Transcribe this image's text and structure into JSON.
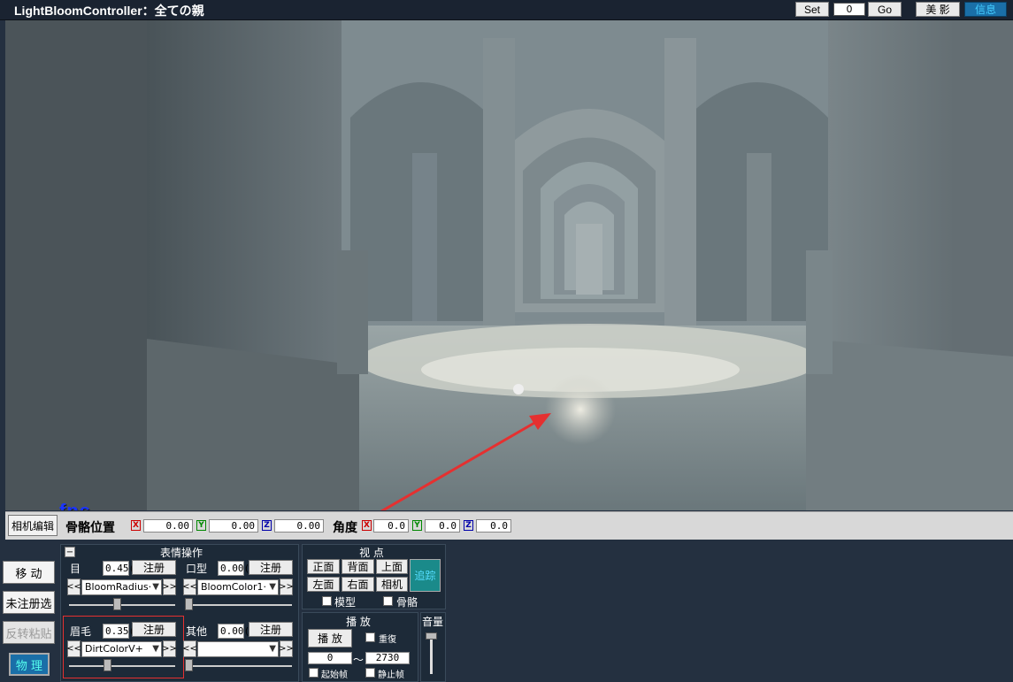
{
  "window": {
    "title": "LightBloomController：全ての親"
  },
  "titlebar": {
    "set_label": "Set",
    "frame_value": "0",
    "go_label": "Go",
    "beauty_label": "美 影",
    "info_label": "信息",
    "accent_color": "#1a6fa8"
  },
  "viewport": {
    "fps_label": "—fps"
  },
  "bone_bar": {
    "camera_edit_label": "相机编辑",
    "bone_position_label": "骨骼位置",
    "angle_label": "角度",
    "axis_labels": [
      "X",
      "Y",
      "Z"
    ],
    "position": {
      "x": "0.00",
      "y": "0.00",
      "z": "0.00"
    },
    "angle": {
      "x": "0.0",
      "y": "0.0",
      "z": "0.0"
    }
  },
  "left_buttons": {
    "move": "移 动",
    "unregistered_select": "未注册选",
    "reverse_paste": "反转粘贴",
    "physics": "物 理"
  },
  "expression": {
    "collapse_label": "−",
    "title": "表情操作",
    "register_label": "注册",
    "eye": {
      "label": "目",
      "value": "0.45(",
      "morph": "BloomRadius·"
    },
    "mouth": {
      "label": "口型",
      "value": "0.00(",
      "morph": "BloomColor1·"
    },
    "brow": {
      "label": "眉毛",
      "value": "0.35(",
      "morph": "DirtColorV+"
    },
    "other": {
      "label": "其他",
      "value": "0.00(",
      "morph": ""
    },
    "prev": "<<",
    "next": ">>"
  },
  "view": {
    "title": "视 点",
    "front": "正面",
    "back": "背面",
    "top": "上面",
    "left": "左面",
    "right": "右面",
    "camera": "相机",
    "track": "追踪",
    "model_label": "模型",
    "bone_label": "骨骼"
  },
  "playback": {
    "title": "播 放",
    "play_label": "播 放",
    "repeat_label": "重復",
    "start_frame": "0",
    "end_frame": "2730",
    "range_sep": "～",
    "start_frame_label": "起始帧",
    "stop_frame_label": "静止帧"
  },
  "volume": {
    "label": "音量"
  }
}
